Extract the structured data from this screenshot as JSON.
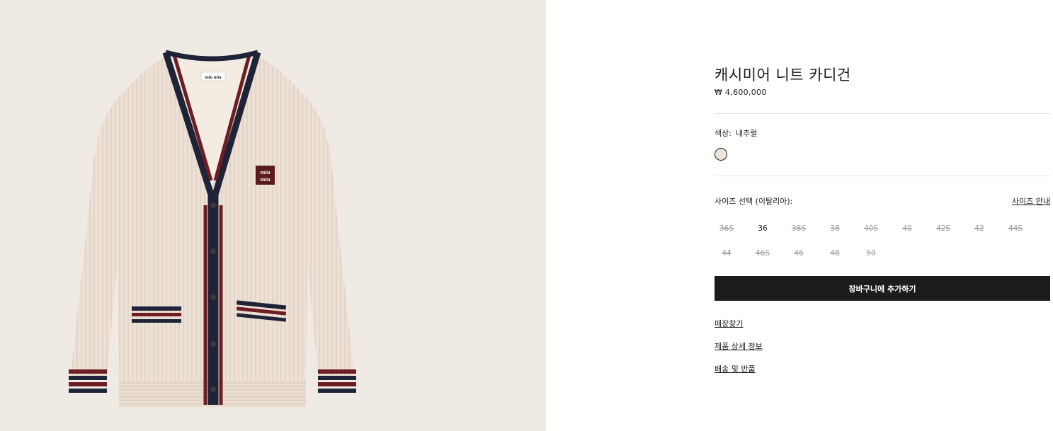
{
  "product": {
    "image_alt": "캐시미어 니트 카디건",
    "logo_text": "miu miu",
    "patch_line1": "miu",
    "patch_line2": "miu",
    "title": "캐시미어 니트 카디건",
    "price": "₩ 4,600,000"
  },
  "color": {
    "label": "색상:",
    "value": "내추럴",
    "swatch_color": "#eee3d9"
  },
  "size": {
    "label": "사이즈 선택 (이탈리아):",
    "guide_label": "사이즈 안내",
    "options": [
      {
        "label": "36S",
        "available": false
      },
      {
        "label": "36",
        "available": true
      },
      {
        "label": "38S",
        "available": false
      },
      {
        "label": "38",
        "available": false
      },
      {
        "label": "40S",
        "available": false
      },
      {
        "label": "40",
        "available": false
      },
      {
        "label": "42S",
        "available": false
      },
      {
        "label": "42",
        "available": false
      },
      {
        "label": "44S",
        "available": false
      },
      {
        "label": "44",
        "available": false
      },
      {
        "label": "46S",
        "available": false
      },
      {
        "label": "46",
        "available": false
      },
      {
        "label": "48",
        "available": false
      },
      {
        "label": "50",
        "available": false
      }
    ]
  },
  "actions": {
    "add_to_cart": "장바구니에 추가하기"
  },
  "links": {
    "store_finder": "매장찾기",
    "product_details": "제품 상세 정보",
    "shipping_returns": "배송 및 반품"
  },
  "colors": {
    "accent_dark": "#1b1c1e",
    "image_background": "#efebe4",
    "knit_body": "#ede1d6",
    "trim_navy": "#1f2337",
    "trim_burgundy": "#6e1d22"
  }
}
